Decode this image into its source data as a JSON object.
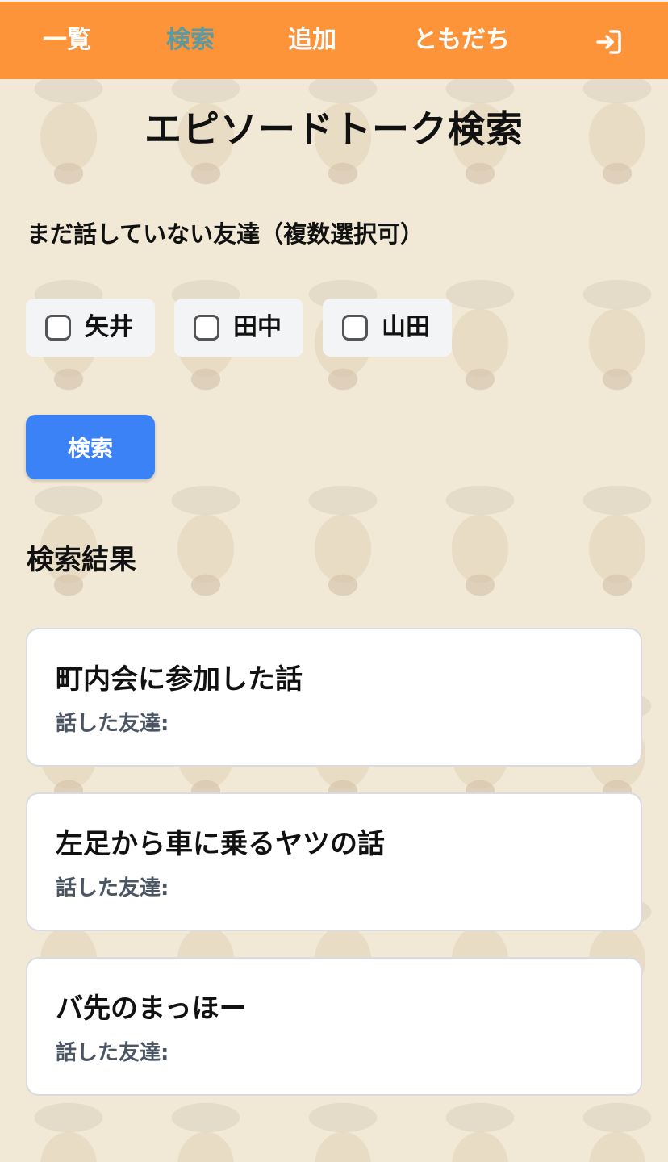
{
  "nav": {
    "items": [
      {
        "label": "一覧",
        "active": false
      },
      {
        "label": "検索",
        "active": true
      },
      {
        "label": "追加",
        "active": false
      },
      {
        "label": "ともだち",
        "active": false
      }
    ],
    "login_icon": "login-arrow-icon",
    "background_color": "#fd9439",
    "active_color": "#5b9aa0"
  },
  "page": {
    "title": "エピソードトーク検索",
    "filter_label": "まだ話していない友達（複数選択可）",
    "friends": [
      {
        "name": "矢井",
        "checked": false
      },
      {
        "name": "田中",
        "checked": false
      },
      {
        "name": "山田",
        "checked": false
      }
    ],
    "search_button": "検索",
    "search_button_color": "#3b82f6",
    "results_heading": "検索結果"
  },
  "results": [
    {
      "title": "町内会に参加した話",
      "meta_label": "話した友達:"
    },
    {
      "title": "左足から車に乗るヤツの話",
      "meta_label": "話した友達:"
    },
    {
      "title": "バ先のまっほー",
      "meta_label": "話した友達:"
    }
  ]
}
